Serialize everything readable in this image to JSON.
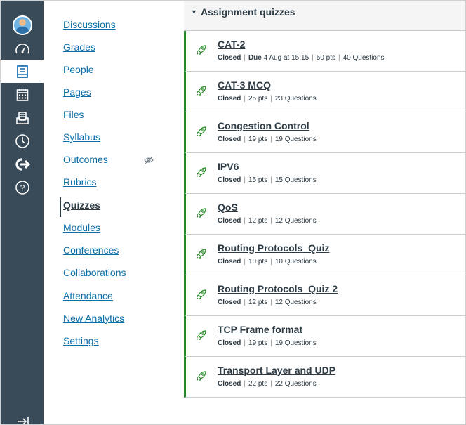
{
  "rail": {
    "items": [
      {
        "icon": "avatar-icon"
      },
      {
        "icon": "dashboard-icon"
      },
      {
        "icon": "courses-icon"
      },
      {
        "icon": "calendar-icon"
      },
      {
        "icon": "inbox-icon"
      },
      {
        "icon": "history-icon"
      },
      {
        "icon": "commons-icon"
      },
      {
        "icon": "help-icon"
      }
    ],
    "active_color": "#ffffff",
    "bg_color": "#394b58"
  },
  "course_nav": {
    "items": [
      {
        "label": "Discussions"
      },
      {
        "label": "Grades"
      },
      {
        "label": "People"
      },
      {
        "label": "Pages"
      },
      {
        "label": "Files"
      },
      {
        "label": "Syllabus"
      },
      {
        "label": "Outcomes"
      },
      {
        "label": "Rubrics"
      },
      {
        "label": "Quizzes"
      },
      {
        "label": "Modules"
      },
      {
        "label": "Conferences"
      },
      {
        "label": "Collaborations"
      },
      {
        "label": "Attendance"
      },
      {
        "label": "New Analytics"
      },
      {
        "label": "Settings"
      }
    ],
    "active": "Quizzes",
    "link_color": "#0b6ea8"
  },
  "group": {
    "title": "Assignment quizzes"
  },
  "quizzes": [
    {
      "title": "CAT-2",
      "status": "Closed",
      "due_label": "Due",
      "due": "4 Aug at 15:15",
      "points": "50 pts",
      "questions": "40 Questions"
    },
    {
      "title": "CAT-3 MCQ",
      "status": "Closed",
      "points": "25 pts",
      "questions": "23 Questions"
    },
    {
      "title": "Congestion Control",
      "status": "Closed",
      "points": "19 pts",
      "questions": "19 Questions"
    },
    {
      "title": "IPV6",
      "status": "Closed",
      "points": "15 pts",
      "questions": "15 Questions"
    },
    {
      "title": "QoS",
      "status": "Closed",
      "points": "12 pts",
      "questions": "12 Questions"
    },
    {
      "title": "Routing Protocols_Quiz",
      "status": "Closed",
      "points": "10 pts",
      "questions": "10 Questions"
    },
    {
      "title": "Routing Protocols_Quiz 2",
      "status": "Closed",
      "points": "12 pts",
      "questions": "12 Questions"
    },
    {
      "title": "TCP Frame format",
      "status": "Closed",
      "points": "19 pts",
      "questions": "19 Questions"
    },
    {
      "title": "Transport Layer and UDP",
      "status": "Closed",
      "points": "22 pts",
      "questions": "22 Questions"
    }
  ],
  "published_color": "#1f8a1f"
}
